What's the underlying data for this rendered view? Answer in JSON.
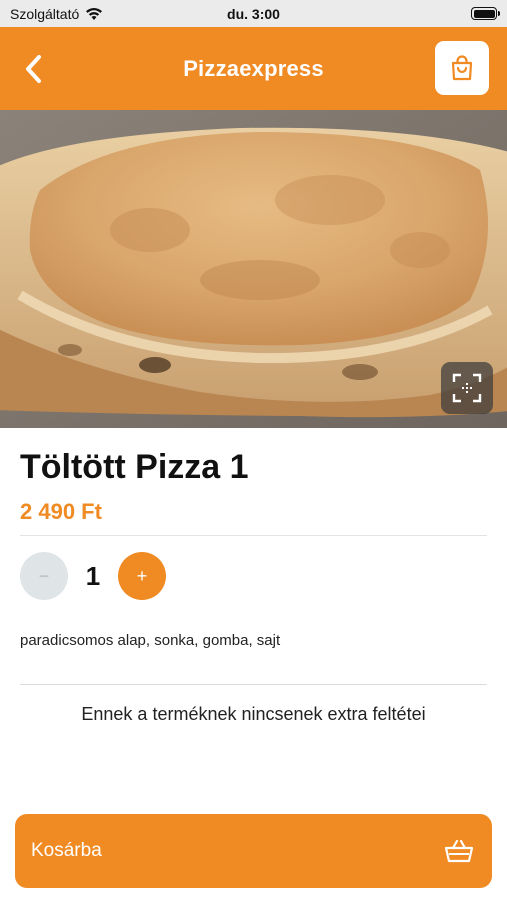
{
  "status_bar": {
    "carrier": "Szolgáltató",
    "time": "du. 3:00"
  },
  "nav": {
    "title": "Pizzaexpress",
    "back_icon": "chevron-left-icon",
    "cart_icon": "shopping-bag-icon"
  },
  "product": {
    "name": "Töltött Pizza 1",
    "price": "2 490 Ft",
    "quantity": "1",
    "minus_label": "−",
    "plus_label": "+",
    "description": "paradicsomos alap, sonka, gomba, sajt",
    "extras_note": "Ennek a terméknek nincsenek extra feltétei"
  },
  "footer": {
    "add_to_cart_label": "Kosárba",
    "basket_icon": "basket-icon"
  },
  "colors": {
    "accent": "#f08a23",
    "minus_bg": "#dfe4e7"
  }
}
